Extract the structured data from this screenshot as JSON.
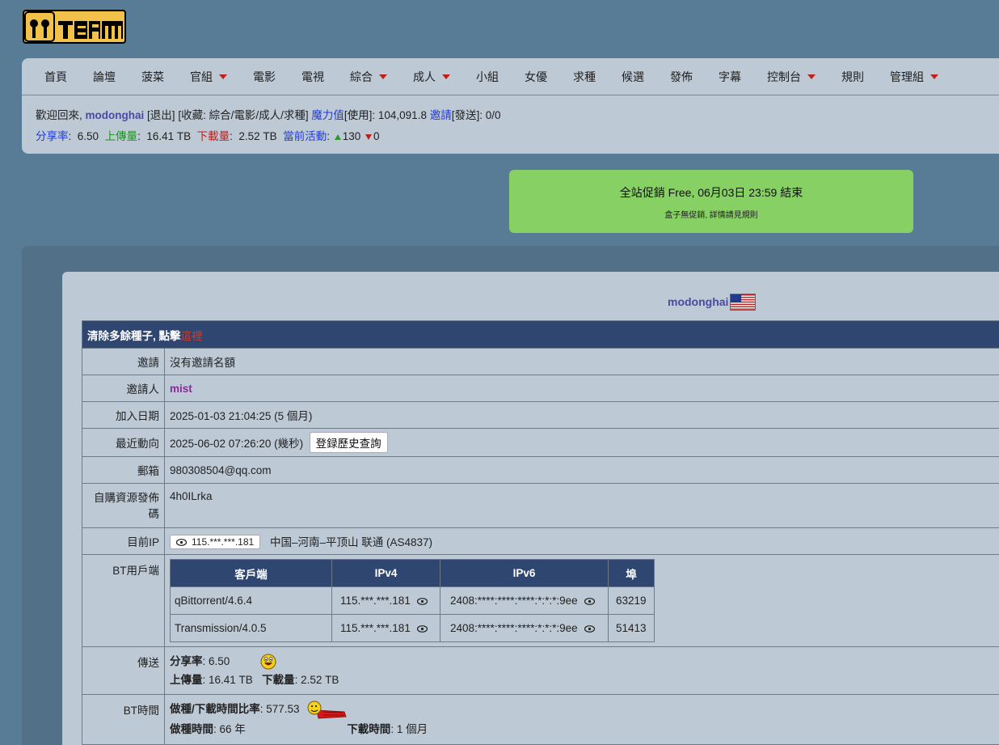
{
  "logo": {
    "text": "MTEAM"
  },
  "nav": {
    "items": [
      {
        "label": "首頁",
        "dropdown": false
      },
      {
        "label": "論壇",
        "dropdown": false
      },
      {
        "label": "菠菜",
        "dropdown": false
      },
      {
        "label": "官組",
        "dropdown": true
      },
      {
        "label": "電影",
        "dropdown": false
      },
      {
        "label": "電視",
        "dropdown": false
      },
      {
        "label": "綜合",
        "dropdown": true
      },
      {
        "label": "成人",
        "dropdown": true
      },
      {
        "label": "小組",
        "dropdown": false
      },
      {
        "label": "女優",
        "dropdown": false
      },
      {
        "label": "求種",
        "dropdown": false
      },
      {
        "label": "候選",
        "dropdown": false
      },
      {
        "label": "發佈",
        "dropdown": false
      },
      {
        "label": "字幕",
        "dropdown": false
      },
      {
        "label": "控制台",
        "dropdown": true
      },
      {
        "label": "規則",
        "dropdown": false
      },
      {
        "label": "管理組",
        "dropdown": true
      }
    ]
  },
  "userbar": {
    "welcome": "歡迎回來,",
    "username": "modonghai",
    "logout": "[退出]",
    "favorites_prefix": "[收藏:",
    "favorites": "綜合/電影/成人/求種]",
    "bonus_label": "魔力值",
    "bonus_text": "[使用]: 104,091.8",
    "invite_label": "邀請",
    "invite_text": "[發送]: 0/0",
    "ratio_label": "分享率",
    "ratio_value": "6.50",
    "upload_label": "上傳量",
    "upload_value": "16.41 TB",
    "download_label": "下載量",
    "download_value": "2.52 TB",
    "activity_label": "當前活動",
    "seeding": "130",
    "leeching": "0"
  },
  "promo": {
    "title": "全站促銷 Free, 06月03日 23:59 結束",
    "subtitle": "盒子無促銷, 詳情請見規則"
  },
  "profile": {
    "username": "modonghai",
    "banner_text": "清除多餘種子, 點擊",
    "banner_link": "這裡",
    "rows": {
      "invite": {
        "label": "邀請",
        "value": "沒有邀請名額"
      },
      "inviter": {
        "label": "邀請人",
        "value": "mist"
      },
      "joined": {
        "label": "加入日期",
        "value": "2025-01-03 21:04:25 (5 個月)"
      },
      "last_seen": {
        "label": "最近動向",
        "value": "2025-06-02 07:26:20 (幾秒)",
        "button": "登録歷史查詢"
      },
      "email": {
        "label": "郵箱",
        "value": "980308504@qq.com"
      },
      "passkey": {
        "label": "自購資源發佈碼",
        "value": "4h0ILrka"
      },
      "ip": {
        "label": "目前IP",
        "ip": "115.***.***.181",
        "location": "中国–河南–平顶山 联通 (AS4837)"
      },
      "bt_clients": {
        "label": "BT用戶端"
      },
      "transfer": {
        "label": "傳送",
        "ratio_label": "分享率",
        "ratio_value": ": 6.50",
        "upload_label": "上傳量",
        "upload_value": ": 16.41 TB",
        "download_label": "下載量",
        "download_value": ": 2.52 TB"
      },
      "bt_time": {
        "label": "BT時間",
        "ratio_label": "做種/下載時間比率",
        "ratio_value": ": 577.53",
        "seed_label": "做種時間",
        "seed_value": ": 66 年",
        "dl_label": "下載時間",
        "dl_value": ": 1 個月"
      }
    },
    "clients": {
      "headers": [
        "客戶端",
        "IPv4",
        "IPv6",
        "埠"
      ],
      "rows": [
        {
          "client": "qBittorrent/4.6.4",
          "ipv4": "115.***.***.181",
          "ipv6": "2408:****:****:****:*:*:*:9ee",
          "port": "63219"
        },
        {
          "client": "Transmission/4.0.5",
          "ipv4": "115.***.***.181",
          "ipv6": "2408:****:****:****:*:*:*:9ee",
          "port": "51413"
        }
      ]
    }
  },
  "colors": {
    "background": "#587b96",
    "panel": "#bdc9d5",
    "header": "#2f4670",
    "promo": "#86d064",
    "accent_red": "#c0201a"
  },
  "flag": "us-flag"
}
